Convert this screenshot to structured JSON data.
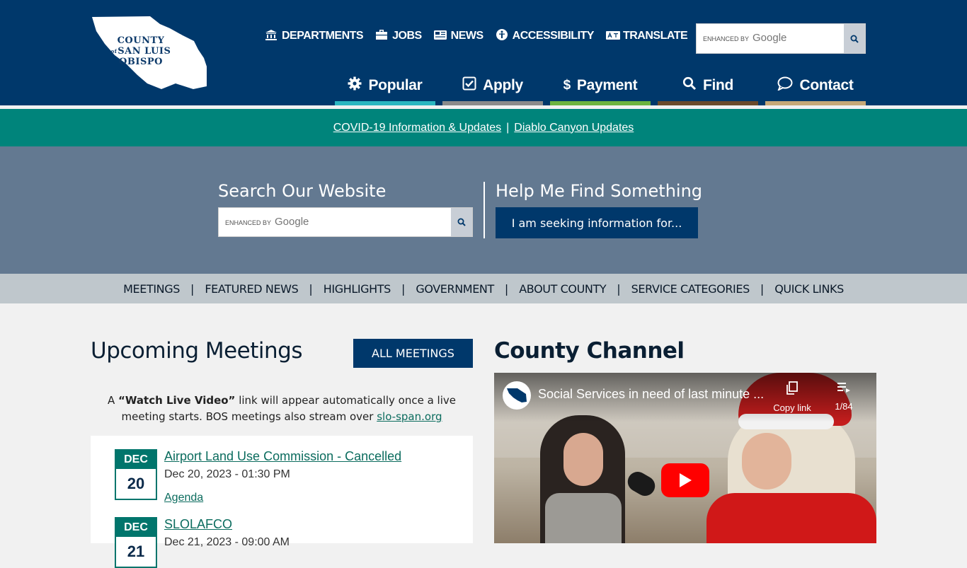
{
  "header": {
    "logo_lines": [
      "COUNTY",
      "SAN LUIS",
      "OBISPO"
    ],
    "logo_of": "of",
    "top_links": [
      {
        "label": "DEPARTMENTS",
        "icon": "building-icon"
      },
      {
        "label": "JOBS",
        "icon": "briefcase-icon"
      },
      {
        "label": "NEWS",
        "icon": "newspaper-icon"
      },
      {
        "label": "ACCESSIBILITY",
        "icon": "accessibility-icon"
      },
      {
        "label": "TRANSLATE",
        "icon": "translate-icon"
      }
    ],
    "search": {
      "enhanced_by": "ENHANCED BY",
      "brand": "Google"
    },
    "main_nav": [
      {
        "label": "Popular",
        "icon": "gear-icon",
        "color": "#2bb6c0"
      },
      {
        "label": "Apply",
        "icon": "checkbox-icon",
        "color": "#8a8a8a"
      },
      {
        "label": "Payment",
        "icon": "dollar-icon",
        "color": "#6cb33f"
      },
      {
        "label": "Find",
        "icon": "search-icon",
        "color": "#6b4a2b"
      },
      {
        "label": "Contact",
        "icon": "chat-icon",
        "color": "#c7a877"
      }
    ]
  },
  "alert": {
    "link1": "COVID-19 Information & Updates",
    "separator": "|",
    "link2": "Diablo Canyon Updates"
  },
  "search_band": {
    "search_title": "Search Our Website",
    "search_enhanced_by": "ENHANCED BY",
    "search_brand": "Google",
    "help_title": "Help Me Find Something",
    "help_button": "I am seeking information for..."
  },
  "section_nav": [
    "MEETINGS",
    "FEATURED NEWS",
    "HIGHLIGHTS",
    "GOVERNMENT",
    "ABOUT COUNTY",
    "SERVICE CATEGORIES",
    "QUICK LINKS"
  ],
  "meetings": {
    "title": "Upcoming Meetings",
    "all_button": "ALL MEETINGS",
    "note_prefix": "A ",
    "note_bold": "“Watch Live Video”",
    "note_mid": " link will appear automatically once a live meeting starts. BOS meetings also stream over ",
    "note_link": "slo-span.org",
    "items": [
      {
        "month": "DEC",
        "day": "20",
        "title": "Airport Land Use Commission - Cancelled",
        "datetime": "Dec 20, 2023 - 01:30 PM",
        "agenda": "Agenda"
      },
      {
        "month": "DEC",
        "day": "21",
        "title": "SLOLAFCO",
        "datetime": "Dec 21, 2023 - 09:00 AM",
        "agenda": ""
      }
    ]
  },
  "channel": {
    "title": "County Channel",
    "video_title": "Social Services in need of last minute ...",
    "copy_link": "Copy link",
    "playlist_count": "1/84"
  }
}
